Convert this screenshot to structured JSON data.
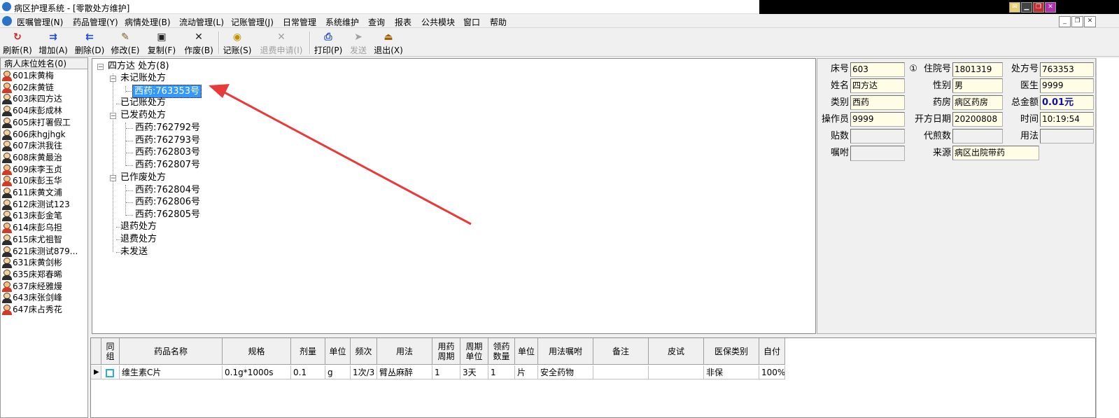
{
  "window": {
    "title": "病区护理系统 - [零散处方维护]"
  },
  "menu": {
    "items": [
      "医嘱管理(N)",
      "药品管理(Y)",
      "病情处理(B)",
      "流动管理(L)",
      "记账管理(J)",
      "日常管理",
      "系统维护",
      "查询",
      "报表",
      "公共模块",
      "窗口",
      "帮助"
    ]
  },
  "toolbar": {
    "refresh": "刷新(R)",
    "add": "增加(A)",
    "delete": "删除(D)",
    "modify": "修改(E)",
    "copy": "复制(F)",
    "void": "作废(B)",
    "bill": "记账(S)",
    "refund_request": "退费申请(I)",
    "print": "打印(P)",
    "send": "发送",
    "exit": "退出(X)"
  },
  "patients": {
    "header": "病人床位姓名(0)",
    "items": [
      {
        "label": "601床黄梅",
        "gender": "f"
      },
      {
        "label": "602床黄链",
        "gender": "f"
      },
      {
        "label": "603床四方达",
        "gender": "m"
      },
      {
        "label": "604床彭成林",
        "gender": "m"
      },
      {
        "label": "605床打署假工",
        "gender": "m"
      },
      {
        "label": "606床hgjhgk",
        "gender": "m"
      },
      {
        "label": "607床洪我往",
        "gender": "m"
      },
      {
        "label": "608床黄最治",
        "gender": "m"
      },
      {
        "label": "609床李玉贞",
        "gender": "f"
      },
      {
        "label": "610床彭玉华",
        "gender": "f"
      },
      {
        "label": "611床黄文浦",
        "gender": "m"
      },
      {
        "label": "612床测试123",
        "gender": "m"
      },
      {
        "label": "613床彭金笔",
        "gender": "m"
      },
      {
        "label": "614床彭乌担",
        "gender": "f"
      },
      {
        "label": "615床尤祖智",
        "gender": "m"
      },
      {
        "label": "621床测试879...",
        "gender": "m"
      },
      {
        "label": "631床黄剑彬",
        "gender": "m"
      },
      {
        "label": "635床郑春晞",
        "gender": "m"
      },
      {
        "label": "637床经雅熳",
        "gender": "f"
      },
      {
        "label": "643床张剑峰",
        "gender": "m"
      },
      {
        "label": "647床占秀花",
        "gender": "f"
      }
    ]
  },
  "tree": {
    "root": "四方达 处方(8)",
    "unbilled": "未记账处方",
    "unbilled_children": [
      "西药:763353号"
    ],
    "billed": "已记账处方",
    "dispensed": "已发药处方",
    "dispensed_children": [
      "西药:762792号",
      "西药:762793号",
      "西药:762803号",
      "西药:762807号"
    ],
    "voided": "已作废处方",
    "voided_children": [
      "西药:762804号",
      "西药:762806号",
      "西药:762805号"
    ],
    "returned": "退药处方",
    "refunded": "退费处方",
    "unsent": "未发送"
  },
  "info": {
    "bed_label": "床号",
    "bed": "603",
    "admit_label": "住院号",
    "admit_prefix": "①",
    "admit": "1801319",
    "rx_label": "处方号",
    "rx": "763353",
    "name_label": "姓名",
    "name": "四方达",
    "gender_label": "性别",
    "gender": "男",
    "doctor_label": "医生",
    "doctor": "9999",
    "type_label": "类别",
    "type": "西药",
    "pharmacy_label": "药房",
    "pharmacy": "病区药房",
    "total_label": "总金额",
    "total": "0.01元",
    "operator_label": "操作员",
    "operator": "9999",
    "date_label": "开方日期",
    "date": "20200808",
    "time_label": "时间",
    "time": "10:19:54",
    "dose_label": "贴数",
    "dose": "",
    "decoct_label": "代煎数",
    "decoct": "",
    "usage_label": "用法",
    "usage": "",
    "note_label": "嘱咐",
    "note": "",
    "source_label": "来源",
    "source": "病区出院带药"
  },
  "grid": {
    "headers": [
      "同\n组",
      "药品名称",
      "规格",
      "剂量",
      "单位",
      "频次",
      "用法",
      "用药\n周期",
      "周期\n单位",
      "领药\n数量",
      "单位",
      "用法嘱咐",
      "备注",
      "皮试",
      "医保类别",
      "自付"
    ],
    "rows": [
      [
        "",
        "维生素C片",
        "0.1g*1000s",
        "0.1",
        "g",
        "1次/3",
        "臂丛麻醉",
        "1",
        "3天",
        "1",
        "片",
        "安全药物",
        "",
        "",
        "非保",
        "100%"
      ]
    ]
  }
}
